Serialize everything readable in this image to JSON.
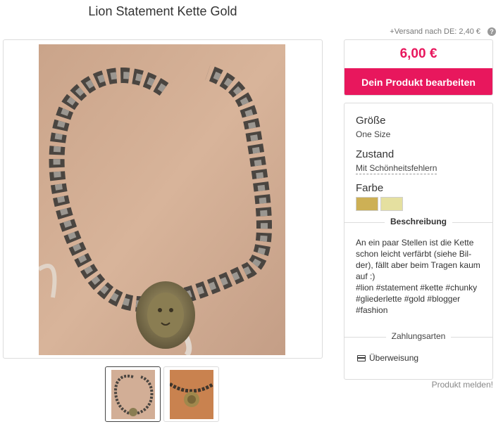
{
  "product": {
    "title": "Lion Statement Kette Gold",
    "shipping": "+Versand nach DE: 2,40 €",
    "price": "6,00 €",
    "edit_button": "Dein Produkt bearbeiten",
    "report_link": "Produkt melden!"
  },
  "attributes": {
    "size_label": "Größe",
    "size_value": "One Size",
    "condition_label": "Zustand",
    "condition_value": "Mit Schönheitsfehlern",
    "color_label": "Farbe",
    "colors": [
      "#cdb055",
      "#e5e0a0"
    ]
  },
  "description": {
    "heading": "Beschreibung",
    "text": "An ein paar Stellen ist die Kette schon leicht verfärbt (siehe Bil-\nder), fällt aber beim Tragen kaum auf :)\n#lion #statement #kette #chunky #gliederlette #gold #blogger #fashion"
  },
  "payment": {
    "heading": "Zahlungsarten",
    "method": "Überweisung",
    "icon": "credit-card-icon"
  },
  "theme": {
    "accent": "#e8175d"
  }
}
